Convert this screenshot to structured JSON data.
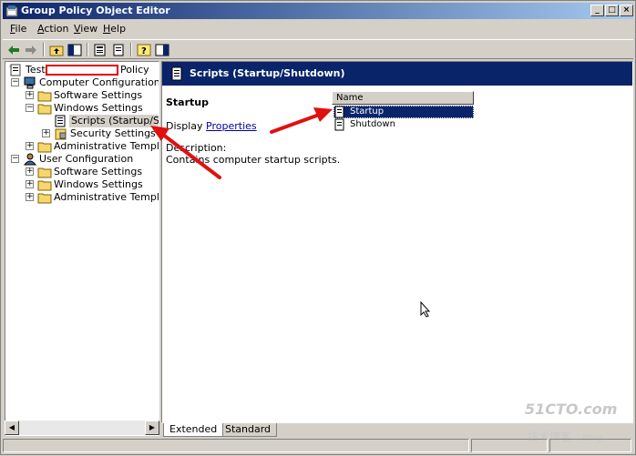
{
  "window": {
    "title": "Group Policy Object Editor"
  },
  "menu": [
    {
      "u": "F",
      "rest": "ile"
    },
    {
      "u": "A",
      "rest": "ction"
    },
    {
      "u": "V",
      "rest": "iew"
    },
    {
      "u": "H",
      "rest": "elp"
    }
  ],
  "tree": {
    "root_prefix": "Test",
    "root_suffix": "Policy",
    "computer_config": "Computer Configuration",
    "software_settings": "Software Settings",
    "windows_settings": "Windows Settings",
    "scripts": "Scripts (Startup/Shutdown)",
    "security_settings": "Security Settings",
    "admin_templates": "Administrative Templates",
    "user_config": "User Configuration",
    "user_software_settings": "Software Settings",
    "user_windows_settings": "Windows Settings",
    "user_admin_templates": "Administrative Templates"
  },
  "right": {
    "header": "Scripts (Startup/Shutdown)",
    "section_title": "Startup",
    "display_prefix": "Display",
    "properties_link": "Properties",
    "description_label": "Description:",
    "description_text": "Contains computer startup scripts.",
    "column_name": "Name",
    "items": [
      "Startup",
      "Shutdown"
    ],
    "selected_item": "Startup"
  },
  "tabs": {
    "extended": "Extended",
    "standard": "Standard"
  },
  "watermark": {
    "line1": "51CTO.com",
    "line2": "技术博客",
    "line3": "Blog"
  },
  "colors": {
    "title_start": "#0a246a",
    "title_end": "#a6caf0",
    "selection": "#0a246a",
    "annotation_arrow": "#e01010"
  }
}
